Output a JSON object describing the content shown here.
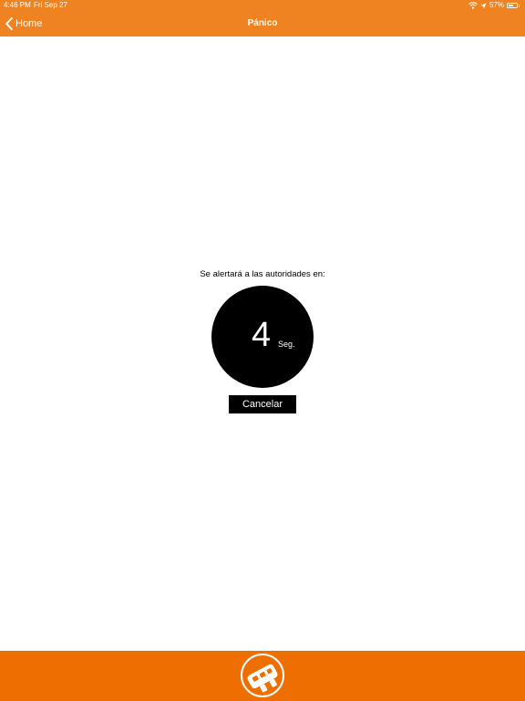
{
  "status_bar": {
    "time": "4:46 PM",
    "date": "Fri Sep 27",
    "battery_percent": "57%",
    "battery_level": 0.57,
    "icons": [
      "wifi-icon",
      "location-arrow-icon",
      "battery-icon"
    ]
  },
  "nav": {
    "back_label": "Home",
    "back_icon": "chevron-left-icon",
    "title": "Pánico"
  },
  "panic": {
    "alert_text": "Se alertará a las autoridades en:",
    "countdown_value": "4",
    "countdown_unit": "Seg.",
    "cancel_label": "Cancelar"
  },
  "bottom_bar": {
    "logo_icon": "panic-button-logo-icon"
  },
  "colors": {
    "top_bar": "#ef8322",
    "bottom_bar": "#ee6f00",
    "background": "#ffffff",
    "circle": "#000000",
    "button": "#000000",
    "text_on_dark": "#ffffff"
  }
}
